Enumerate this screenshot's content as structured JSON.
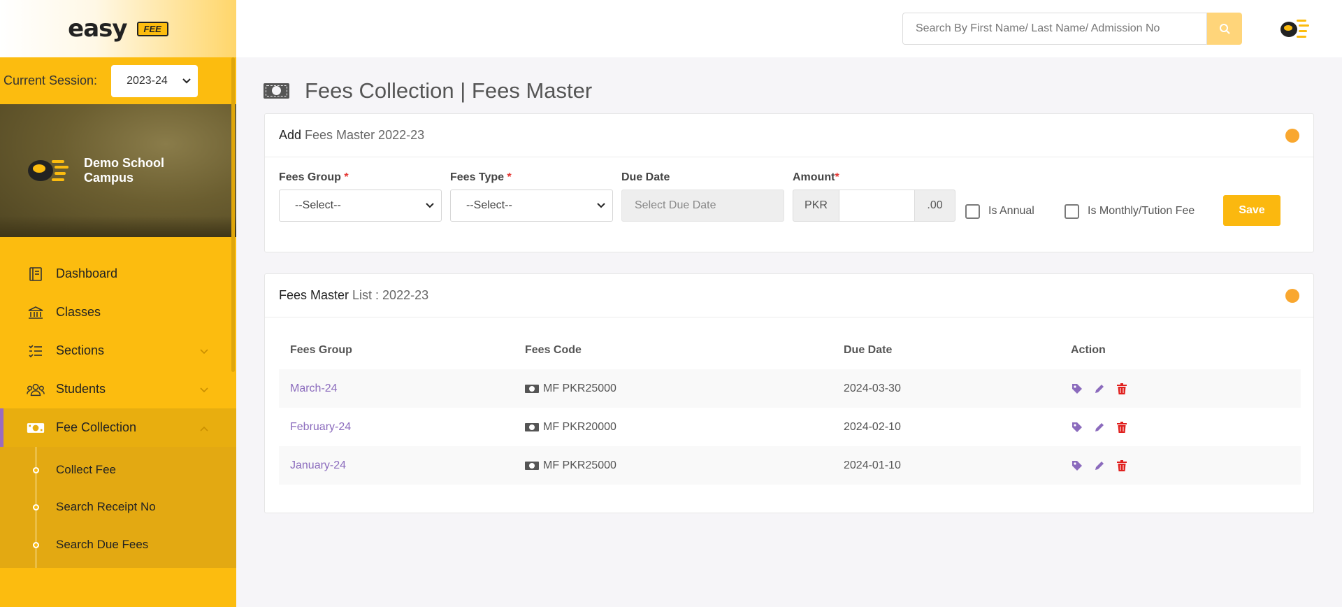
{
  "brand": {
    "word": "easy",
    "tag": "FEE"
  },
  "session": {
    "label": "Current Session:",
    "value": "2023-24"
  },
  "campus": {
    "name": "Demo School Campus"
  },
  "sidebar": {
    "items": [
      {
        "label": "Dashboard",
        "icon": "dashboard-icon"
      },
      {
        "label": "Classes",
        "icon": "bank-icon"
      },
      {
        "label": "Sections",
        "icon": "list-icon"
      },
      {
        "label": "Students",
        "icon": "users-icon"
      },
      {
        "label": "Fee Collection",
        "icon": "cash-icon"
      }
    ],
    "submenu": [
      {
        "label": "Collect Fee"
      },
      {
        "label": "Search Receipt No"
      },
      {
        "label": "Search Due Fees"
      }
    ]
  },
  "search": {
    "placeholder": "Search By First Name/ Last Name/ Admission No"
  },
  "page": {
    "title": "Fees Collection | Fees Master"
  },
  "add_card": {
    "title_bold": "Add",
    "title_light": "Fees Master 2022-23",
    "fields": {
      "fees_group_label": "Fees Group",
      "fees_group_value": "--Select--",
      "fees_type_label": "Fees Type",
      "fees_type_value": "--Select--",
      "due_date_label": "Due Date",
      "due_date_placeholder": "Select Due Date",
      "amount_label": "Amount",
      "amount_prefix": "PKR",
      "amount_suffix": ".00",
      "required_mark": "*"
    },
    "is_annual_label": "Is Annual",
    "is_monthly_label": "Is Monthly/Tution Fee",
    "save_label": "Save"
  },
  "list_card": {
    "title_bold": "Fees Master",
    "title_light": "List : 2022-23",
    "columns": [
      "Fees Group",
      "Fees Code",
      "Due Date",
      "Action"
    ],
    "rows": [
      {
        "group": "March-24",
        "code": "MF PKR25000",
        "due": "2024-03-30"
      },
      {
        "group": "February-24",
        "code": "MF PKR20000",
        "due": "2024-02-10"
      },
      {
        "group": "January-24",
        "code": "MF PKR25000",
        "due": "2024-01-10"
      }
    ]
  },
  "colors": {
    "brand_yellow": "#fcbc0f",
    "status_orange": "#f9a72f",
    "link_purple": "#8b6bbd",
    "delete_red": "#e0201e"
  }
}
